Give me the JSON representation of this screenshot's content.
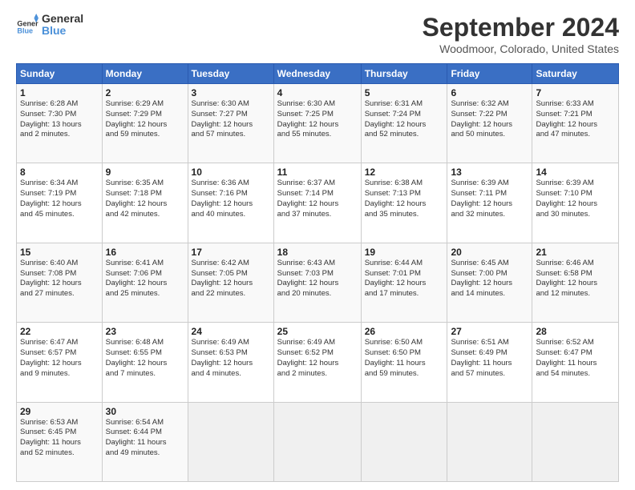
{
  "header": {
    "title": "September 2024",
    "subtitle": "Woodmoor, Colorado, United States"
  },
  "calendar": {
    "headers": [
      "Sunday",
      "Monday",
      "Tuesday",
      "Wednesday",
      "Thursday",
      "Friday",
      "Saturday"
    ],
    "weeks": [
      [
        {
          "day": "",
          "info": ""
        },
        {
          "day": "2",
          "info": "Sunrise: 6:29 AM\nSunset: 7:29 PM\nDaylight: 12 hours\nand 59 minutes."
        },
        {
          "day": "3",
          "info": "Sunrise: 6:30 AM\nSunset: 7:27 PM\nDaylight: 12 hours\nand 57 minutes."
        },
        {
          "day": "4",
          "info": "Sunrise: 6:30 AM\nSunset: 7:25 PM\nDaylight: 12 hours\nand 55 minutes."
        },
        {
          "day": "5",
          "info": "Sunrise: 6:31 AM\nSunset: 7:24 PM\nDaylight: 12 hours\nand 52 minutes."
        },
        {
          "day": "6",
          "info": "Sunrise: 6:32 AM\nSunset: 7:22 PM\nDaylight: 12 hours\nand 50 minutes."
        },
        {
          "day": "7",
          "info": "Sunrise: 6:33 AM\nSunset: 7:21 PM\nDaylight: 12 hours\nand 47 minutes."
        }
      ],
      [
        {
          "day": "1",
          "info": "Sunrise: 6:28 AM\nSunset: 7:30 PM\nDaylight: 13 hours\nand 2 minutes."
        },
        {
          "day": "9",
          "info": "Sunrise: 6:35 AM\nSunset: 7:18 PM\nDaylight: 12 hours\nand 42 minutes."
        },
        {
          "day": "10",
          "info": "Sunrise: 6:36 AM\nSunset: 7:16 PM\nDaylight: 12 hours\nand 40 minutes."
        },
        {
          "day": "11",
          "info": "Sunrise: 6:37 AM\nSunset: 7:14 PM\nDaylight: 12 hours\nand 37 minutes."
        },
        {
          "day": "12",
          "info": "Sunrise: 6:38 AM\nSunset: 7:13 PM\nDaylight: 12 hours\nand 35 minutes."
        },
        {
          "day": "13",
          "info": "Sunrise: 6:39 AM\nSunset: 7:11 PM\nDaylight: 12 hours\nand 32 minutes."
        },
        {
          "day": "14",
          "info": "Sunrise: 6:39 AM\nSunset: 7:10 PM\nDaylight: 12 hours\nand 30 minutes."
        }
      ],
      [
        {
          "day": "8",
          "info": "Sunrise: 6:34 AM\nSunset: 7:19 PM\nDaylight: 12 hours\nand 45 minutes."
        },
        {
          "day": "16",
          "info": "Sunrise: 6:41 AM\nSunset: 7:06 PM\nDaylight: 12 hours\nand 25 minutes."
        },
        {
          "day": "17",
          "info": "Sunrise: 6:42 AM\nSunset: 7:05 PM\nDaylight: 12 hours\nand 22 minutes."
        },
        {
          "day": "18",
          "info": "Sunrise: 6:43 AM\nSunset: 7:03 PM\nDaylight: 12 hours\nand 20 minutes."
        },
        {
          "day": "19",
          "info": "Sunrise: 6:44 AM\nSunset: 7:01 PM\nDaylight: 12 hours\nand 17 minutes."
        },
        {
          "day": "20",
          "info": "Sunrise: 6:45 AM\nSunset: 7:00 PM\nDaylight: 12 hours\nand 14 minutes."
        },
        {
          "day": "21",
          "info": "Sunrise: 6:46 AM\nSunset: 6:58 PM\nDaylight: 12 hours\nand 12 minutes."
        }
      ],
      [
        {
          "day": "15",
          "info": "Sunrise: 6:40 AM\nSunset: 7:08 PM\nDaylight: 12 hours\nand 27 minutes."
        },
        {
          "day": "23",
          "info": "Sunrise: 6:48 AM\nSunset: 6:55 PM\nDaylight: 12 hours\nand 7 minutes."
        },
        {
          "day": "24",
          "info": "Sunrise: 6:49 AM\nSunset: 6:53 PM\nDaylight: 12 hours\nand 4 minutes."
        },
        {
          "day": "25",
          "info": "Sunrise: 6:49 AM\nSunset: 6:52 PM\nDaylight: 12 hours\nand 2 minutes."
        },
        {
          "day": "26",
          "info": "Sunrise: 6:50 AM\nSunset: 6:50 PM\nDaylight: 11 hours\nand 59 minutes."
        },
        {
          "day": "27",
          "info": "Sunrise: 6:51 AM\nSunset: 6:49 PM\nDaylight: 11 hours\nand 57 minutes."
        },
        {
          "day": "28",
          "info": "Sunrise: 6:52 AM\nSunset: 6:47 PM\nDaylight: 11 hours\nand 54 minutes."
        }
      ],
      [
        {
          "day": "22",
          "info": "Sunrise: 6:47 AM\nSunset: 6:57 PM\nDaylight: 12 hours\nand 9 minutes."
        },
        {
          "day": "30",
          "info": "Sunrise: 6:54 AM\nSunset: 6:44 PM\nDaylight: 11 hours\nand 49 minutes."
        },
        {
          "day": "",
          "info": ""
        },
        {
          "day": "",
          "info": ""
        },
        {
          "day": "",
          "info": ""
        },
        {
          "day": "",
          "info": ""
        },
        {
          "day": "",
          "info": ""
        }
      ],
      [
        {
          "day": "29",
          "info": "Sunrise: 6:53 AM\nSunset: 6:45 PM\nDaylight: 11 hours\nand 52 minutes."
        },
        {
          "day": "",
          "info": ""
        },
        {
          "day": "",
          "info": ""
        },
        {
          "day": "",
          "info": ""
        },
        {
          "day": "",
          "info": ""
        },
        {
          "day": "",
          "info": ""
        },
        {
          "day": "",
          "info": ""
        }
      ]
    ]
  }
}
